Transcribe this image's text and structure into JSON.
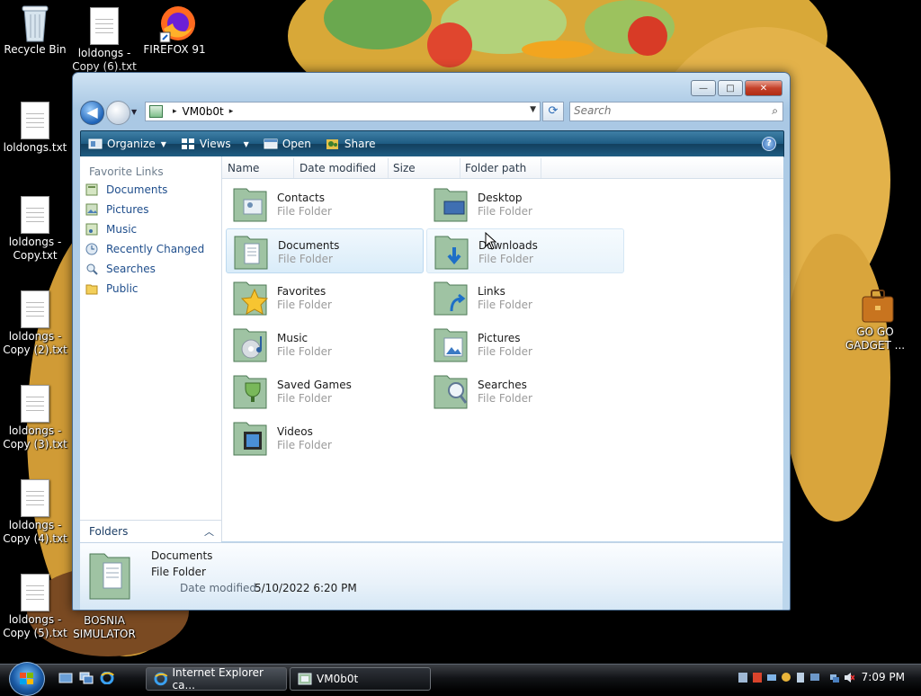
{
  "desktop": {
    "icons": [
      {
        "label": "Recycle Bin",
        "icon": "recycle-bin-icon"
      },
      {
        "label": "loldongs - Copy (6).txt",
        "icon": "text-file-icon"
      },
      {
        "label": "FIREFOX 91",
        "icon": "firefox-icon"
      },
      {
        "label": "loldongs.txt",
        "icon": "text-file-icon"
      },
      {
        "label": "loldongs - Copy.txt",
        "icon": "text-file-icon"
      },
      {
        "label": "loldongs - Copy (2).txt",
        "icon": "text-file-icon"
      },
      {
        "label": "loldongs - Copy (3).txt",
        "icon": "text-file-icon"
      },
      {
        "label": "loldongs - Copy (4).txt",
        "icon": "text-file-icon"
      },
      {
        "label": "loldongs - Copy (5).txt",
        "icon": "text-file-icon"
      },
      {
        "label": "BOSNIA SIMULATOR",
        "icon": "application-icon"
      },
      {
        "label": "GO GO GADGET ...",
        "icon": "briefcase-icon"
      }
    ]
  },
  "window": {
    "caption_buttons": {
      "minimize": "—",
      "maximize": "□",
      "close": "✕"
    },
    "address": {
      "path": "VM0b0t",
      "separator": "▸"
    },
    "search": {
      "placeholder": "Search"
    },
    "command_bar": {
      "organize": "Organize",
      "views": "Views",
      "open": "Open",
      "share": "Share"
    },
    "nav_pane": {
      "title": "Favorite Links",
      "links": [
        {
          "label": "Documents",
          "icon": "documents-icon"
        },
        {
          "label": "Pictures",
          "icon": "pictures-icon"
        },
        {
          "label": "Music",
          "icon": "music-icon"
        },
        {
          "label": "Recently Changed",
          "icon": "recently-changed-icon"
        },
        {
          "label": "Searches",
          "icon": "searches-icon"
        },
        {
          "label": "Public",
          "icon": "public-folder-icon"
        }
      ],
      "folders_label": "Folders"
    },
    "columns": [
      "Name",
      "Date modified",
      "Size",
      "Folder path"
    ],
    "items": [
      {
        "name": "Contacts",
        "type": "File Folder",
        "icon": "contacts-folder-icon"
      },
      {
        "name": "Desktop",
        "type": "File Folder",
        "icon": "desktop-folder-icon"
      },
      {
        "name": "Documents",
        "type": "File Folder",
        "icon": "documents-folder-icon",
        "state": "selected"
      },
      {
        "name": "Downloads",
        "type": "File Folder",
        "icon": "downloads-folder-icon",
        "state": "hover"
      },
      {
        "name": "Favorites",
        "type": "File Folder",
        "icon": "favorites-folder-icon"
      },
      {
        "name": "Links",
        "type": "File Folder",
        "icon": "links-folder-icon"
      },
      {
        "name": "Music",
        "type": "File Folder",
        "icon": "music-folder-icon"
      },
      {
        "name": "Pictures",
        "type": "File Folder",
        "icon": "pictures-folder-icon"
      },
      {
        "name": "Saved Games",
        "type": "File Folder",
        "icon": "saved-games-folder-icon"
      },
      {
        "name": "Searches",
        "type": "File Folder",
        "icon": "searches-folder-icon"
      },
      {
        "name": "Videos",
        "type": "File Folder",
        "icon": "videos-folder-icon"
      }
    ],
    "details": {
      "name": "Documents",
      "type": "File Folder",
      "date_label": "Date modified:",
      "date_value": "5/10/2022 6:20 PM"
    }
  },
  "taskbar": {
    "tasks": [
      {
        "label": "Internet Explorer ca...",
        "icon": "internet-explorer-icon"
      },
      {
        "label": "VM0b0t",
        "icon": "folder-window-icon",
        "active": true
      }
    ],
    "clock": "7:09 PM"
  },
  "colors": {
    "accent": "#1d5b82",
    "link": "#1f4e8c",
    "selection": "#d9ecf9"
  }
}
